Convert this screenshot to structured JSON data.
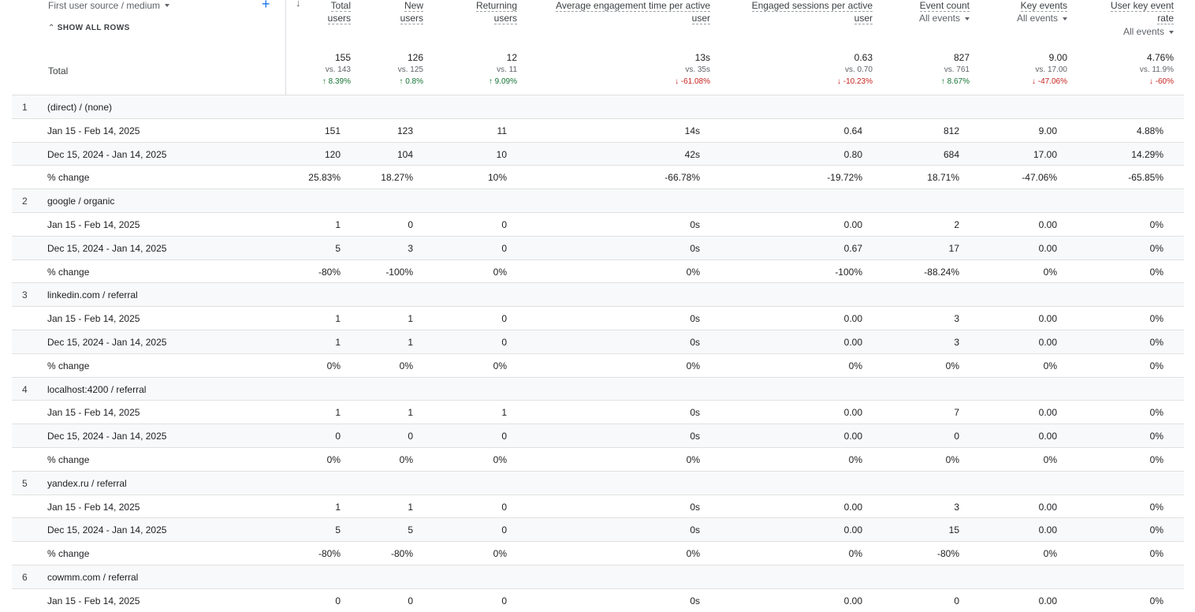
{
  "header": {
    "dimension_label": "First user source / medium",
    "show_all_rows": "SHOW ALL ROWS",
    "add_icon": "plus-icon",
    "sort_icon": "arrow-down-icon",
    "columns": [
      {
        "line1": "Total",
        "line2": "users",
        "sub": ""
      },
      {
        "line1": "New",
        "line2": "users",
        "sub": ""
      },
      {
        "line1": "Returning",
        "line2": "users",
        "sub": ""
      },
      {
        "line1": "Average engagement time per active",
        "line2": "user",
        "sub": ""
      },
      {
        "line1": "Engaged sessions per active",
        "line2": "user",
        "sub": ""
      },
      {
        "line1": "Event count",
        "line2": "",
        "sub": "All events"
      },
      {
        "line1": "Key events",
        "line2": "",
        "sub": "All events"
      },
      {
        "line1": "User key event",
        "line2": "rate",
        "sub": "All events"
      }
    ]
  },
  "totals": {
    "label": "Total",
    "values": [
      {
        "v": "155",
        "vs": "vs. 143",
        "ch": "↑ 8.39%",
        "dir": "up"
      },
      {
        "v": "126",
        "vs": "vs. 125",
        "ch": "↑ 0.8%",
        "dir": "up"
      },
      {
        "v": "12",
        "vs": "vs. 11",
        "ch": "↑ 9.09%",
        "dir": "up"
      },
      {
        "v": "13s",
        "vs": "vs. 35s",
        "ch": "↓ -61.08%",
        "dir": "down"
      },
      {
        "v": "0.63",
        "vs": "vs. 0.70",
        "ch": "↓ -10.23%",
        "dir": "down"
      },
      {
        "v": "827",
        "vs": "vs. 761",
        "ch": "↑ 8.67%",
        "dir": "up"
      },
      {
        "v": "9.00",
        "vs": "vs. 17.00",
        "ch": "↓ -47.06%",
        "dir": "down"
      },
      {
        "v": "4.76%",
        "vs": "vs. 11.9%",
        "ch": "↓ -60%",
        "dir": "down"
      }
    ]
  },
  "groups": [
    {
      "index": "1",
      "name": "(direct) / (none)",
      "rows": [
        {
          "label": "Jan 15 - Feb 14, 2025",
          "cells": [
            "151",
            "123",
            "11",
            "14s",
            "0.64",
            "812",
            "9.00",
            "4.88%"
          ]
        },
        {
          "label": "Dec 15, 2024 - Jan 14, 2025",
          "cells": [
            "120",
            "104",
            "10",
            "42s",
            "0.80",
            "684",
            "17.00",
            "14.29%"
          ]
        },
        {
          "label": "% change",
          "cells": [
            "25.83%",
            "18.27%",
            "10%",
            "-66.78%",
            "-19.72%",
            "18.71%",
            "-47.06%",
            "-65.85%"
          ]
        }
      ]
    },
    {
      "index": "2",
      "name": "google / organic",
      "rows": [
        {
          "label": "Jan 15 - Feb 14, 2025",
          "cells": [
            "1",
            "0",
            "0",
            "0s",
            "0.00",
            "2",
            "0.00",
            "0%"
          ]
        },
        {
          "label": "Dec 15, 2024 - Jan 14, 2025",
          "cells": [
            "5",
            "3",
            "0",
            "0s",
            "0.67",
            "17",
            "0.00",
            "0%"
          ]
        },
        {
          "label": "% change",
          "cells": [
            "-80%",
            "-100%",
            "0%",
            "0%",
            "-100%",
            "-88.24%",
            "0%",
            "0%"
          ]
        }
      ]
    },
    {
      "index": "3",
      "name": "linkedin.com / referral",
      "rows": [
        {
          "label": "Jan 15 - Feb 14, 2025",
          "cells": [
            "1",
            "1",
            "0",
            "0s",
            "0.00",
            "3",
            "0.00",
            "0%"
          ]
        },
        {
          "label": "Dec 15, 2024 - Jan 14, 2025",
          "cells": [
            "1",
            "1",
            "0",
            "0s",
            "0.00",
            "3",
            "0.00",
            "0%"
          ]
        },
        {
          "label": "% change",
          "cells": [
            "0%",
            "0%",
            "0%",
            "0%",
            "0%",
            "0%",
            "0%",
            "0%"
          ]
        }
      ]
    },
    {
      "index": "4",
      "name": "localhost:4200 / referral",
      "rows": [
        {
          "label": "Jan 15 - Feb 14, 2025",
          "cells": [
            "1",
            "1",
            "1",
            "0s",
            "0.00",
            "7",
            "0.00",
            "0%"
          ]
        },
        {
          "label": "Dec 15, 2024 - Jan 14, 2025",
          "cells": [
            "0",
            "0",
            "0",
            "0s",
            "0.00",
            "0",
            "0.00",
            "0%"
          ]
        },
        {
          "label": "% change",
          "cells": [
            "0%",
            "0%",
            "0%",
            "0%",
            "0%",
            "0%",
            "0%",
            "0%"
          ]
        }
      ]
    },
    {
      "index": "5",
      "name": "yandex.ru / referral",
      "rows": [
        {
          "label": "Jan 15 - Feb 14, 2025",
          "cells": [
            "1",
            "1",
            "0",
            "0s",
            "0.00",
            "3",
            "0.00",
            "0%"
          ]
        },
        {
          "label": "Dec 15, 2024 - Jan 14, 2025",
          "cells": [
            "5",
            "5",
            "0",
            "0s",
            "0.00",
            "15",
            "0.00",
            "0%"
          ]
        },
        {
          "label": "% change",
          "cells": [
            "-80%",
            "-80%",
            "0%",
            "0%",
            "0%",
            "-80%",
            "0%",
            "0%"
          ]
        }
      ]
    },
    {
      "index": "6",
      "name": "cowmm.com / referral",
      "rows": [
        {
          "label": "Jan 15 - Feb 14, 2025",
          "cells": [
            "0",
            "0",
            "0",
            "0s",
            "0.00",
            "0",
            "0.00",
            "0%"
          ]
        }
      ]
    }
  ],
  "colors": {
    "up": "#137333",
    "down": "#c5221f",
    "accent": "#1a73e8"
  }
}
